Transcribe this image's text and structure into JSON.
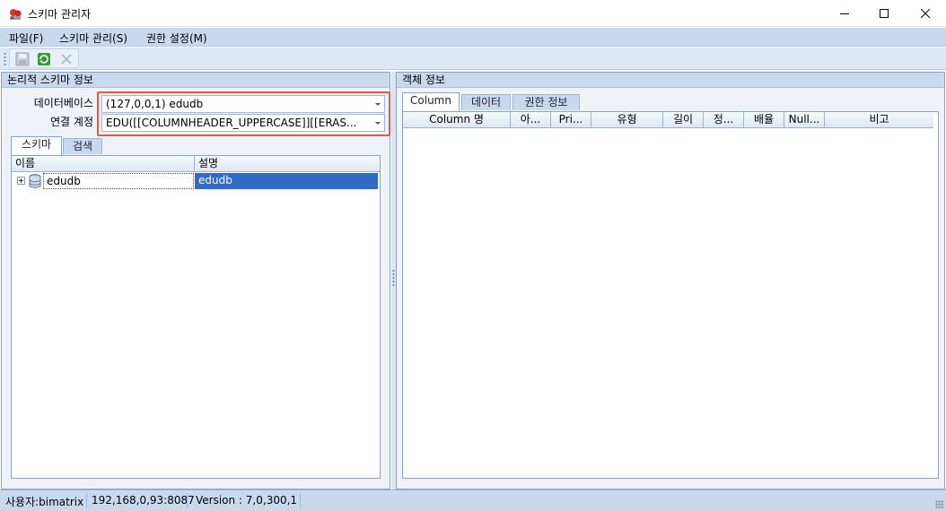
{
  "window": {
    "title": "스키마 관리자",
    "icon": "app-logo-icon"
  },
  "menu": [
    "파일(F)",
    "스키마 관리(S)",
    "권한 설정(M)"
  ],
  "toolbar": {
    "buttons": [
      "save-icon",
      "refresh-icon",
      "delete-icon"
    ]
  },
  "left_panel": {
    "title": "논리적 스키마 정보",
    "database_label": "데이터베이스",
    "database_value": "(127,0,0,1) edudb",
    "account_label": "연결 계정",
    "account_value": "EDU([[COLUMNHEADER_UPPERCASE]][[ERAS...",
    "tabs": [
      "스키마",
      "검색"
    ],
    "grid_headers": [
      "이름",
      "설명"
    ],
    "rows": [
      {
        "name": "edudb",
        "description": "edudb"
      }
    ]
  },
  "right_panel": {
    "title": "객체 정보",
    "tabs": [
      "Column",
      "데이터",
      "권한 정보"
    ],
    "grid_headers": [
      "Column 명",
      "아...",
      "Pri...",
      "유형",
      "길이",
      "정...",
      "배율",
      "Null...",
      "비고"
    ]
  },
  "status": {
    "user": "사용자:bimatrix",
    "server": "192,168,0,93:8087",
    "version": "Version : 7,0,300,1"
  },
  "colors": {
    "accent": "#316ac5",
    "panel_header": "#c8d9ee",
    "highlight_box": "#e05a4a"
  }
}
